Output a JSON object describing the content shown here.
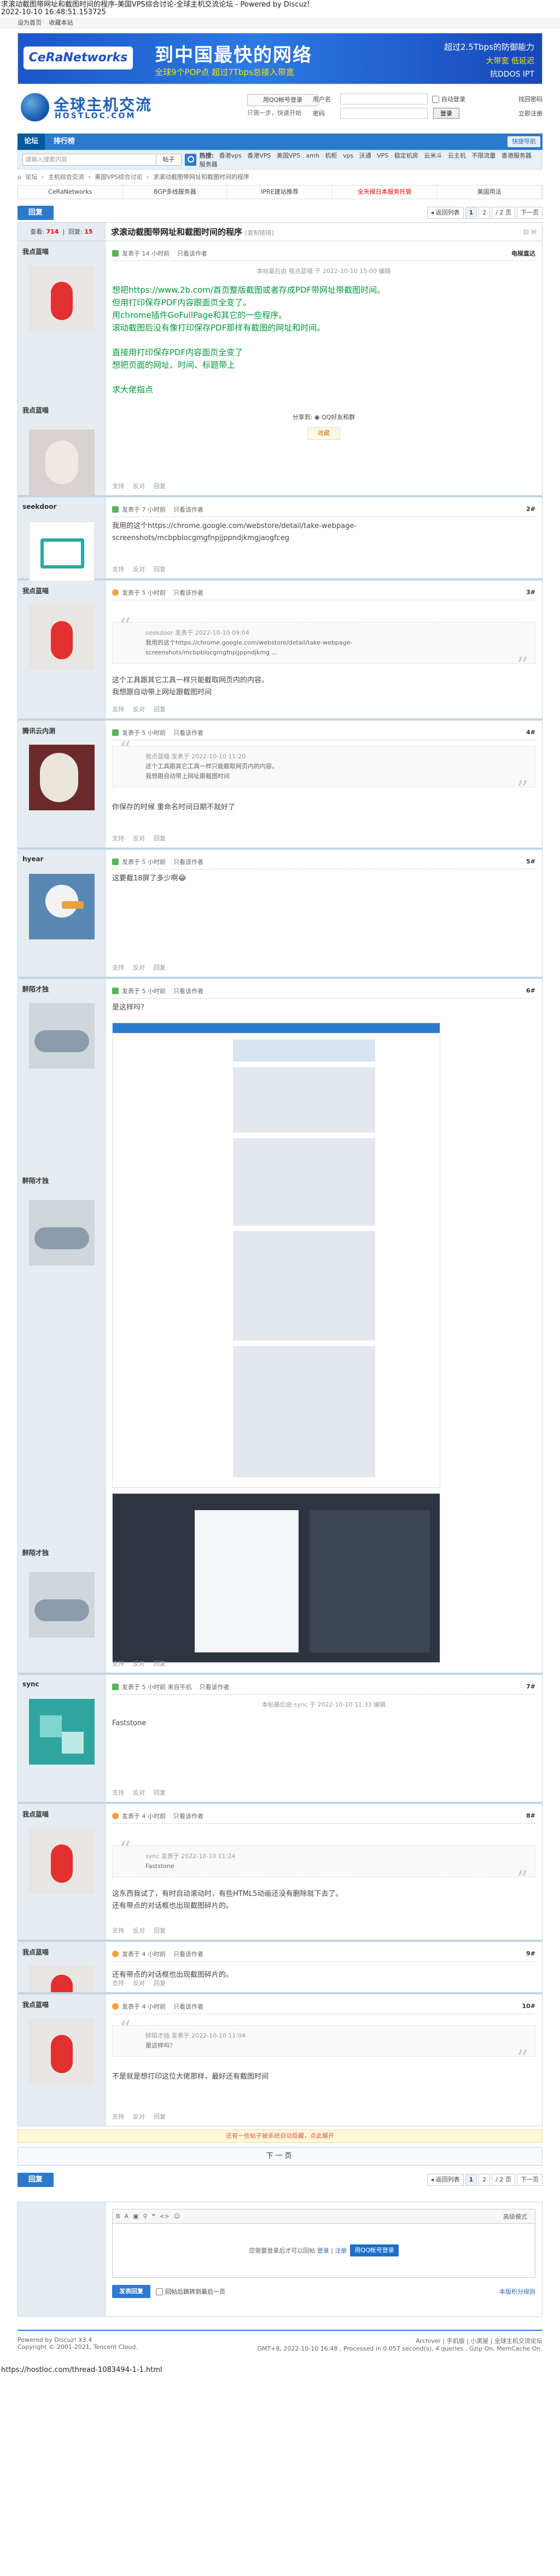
{
  "print_header": {
    "title": "求滚动截图带网址和截图时间的程序-美国VPS综合讨论-全球主机交流论坛 - Powered by Discuz!",
    "timestamp": "2022-10-10 16:48:51.153725"
  },
  "topbar": {
    "set_home": "设为首页",
    "favorite": "收藏本站"
  },
  "ad_banner": {
    "logo": "CeRaNetworks",
    "headline": "到中国最快的网络",
    "subline": "全球9个POP点  超过7Tbps总接入带宽",
    "right1": "超过2.5Tbps的防御能力",
    "right2": "大带宽 低延迟",
    "right3": "抗DDOS IPT"
  },
  "site": {
    "logo_cn": "全球主机交流",
    "logo_en": "HOSTLOC.COM",
    "qq_login": "用QQ帐号登录",
    "qq_tip": "只需一步，快速开始"
  },
  "login": {
    "user_label": "用户名",
    "pass_label": "密码",
    "autologin": "自动登录",
    "forgot": "找回密码",
    "login_btn": "登录",
    "register": "立即注册"
  },
  "nav": {
    "items": [
      "论坛",
      "排行榜"
    ],
    "quick": "快捷导航"
  },
  "search": {
    "placeholder": "请输入搜索内容",
    "scope": "帖子",
    "hot_label": "热搜:",
    "hot": [
      "香港vps",
      "香港VPS",
      "美国VPS",
      "amh",
      "机柜",
      "vps",
      "沃通",
      "VPS",
      "稳定机房",
      "云米斗",
      "云主机",
      "不限流量",
      "香港服务器",
      "服务器"
    ]
  },
  "breadcrumb": [
    "论坛",
    "›",
    "主机综合交流",
    "›",
    "美国VPS综合讨论",
    "›",
    "求滚动截图带网址和截图时间的程序"
  ],
  "links": [
    "CeRaNetworks",
    "BGP多线服务器",
    "IPRE建站推荐",
    "全天候日本服务托管",
    "美国用法"
  ],
  "pagination": {
    "back": "◂ 返回列表",
    "pages": [
      "1",
      "2"
    ],
    "total": "/ 2 页",
    "next": "下一页",
    "reply": "回复"
  },
  "thread": {
    "views_label": "查看:",
    "views": "714",
    "replies_label": "回复:",
    "replies": "15",
    "title": "求滚动截图带网址和截图时间的程序",
    "copy_link": "[复制链接]",
    "tools": "⊟ ✉"
  },
  "posts": [
    {
      "author": "我点蓝喵",
      "meta": "发表于 14 小时前",
      "only_author": "只看该作者",
      "floor": "电梯直达",
      "edited": "本帖最后由 我点蓝喵 于 2022-10-10 15:00 编辑",
      "lines": [
        "想把https://www.2b.com/首页整版截图或者存成PDF带网址带截图时间。",
        "但用打印保存PDF内容跟面页全变了。",
        "用chrome插件GoFullPage和其它的一些程序。",
        "滚动截图后没有像打印保存PDF那样有截图的网址和时间。",
        "",
        "直接用打印保存PDF内容面页全变了",
        "想把页面的网址、时间、标题带上",
        "",
        "求大佬指点"
      ],
      "share": "分享到: ◉ QQ好友和群",
      "fav": "收藏"
    },
    {
      "author": "seekdoor",
      "meta": "发表于 7 小时前",
      "only_author": "只看该作者",
      "floor": "2#",
      "lines": [
        "我用的这个https://chrome.google.com/webstore/detail/take-webpage-",
        "screenshots/mcbpblocgmgfnpjjppndjkmgjaogfceg"
      ]
    },
    {
      "author": "我点蓝喵",
      "meta": "发表于 5 小时前",
      "only_author": "只看该作者",
      "floor": "3#",
      "quote_head": "seekdoor 发表于 2022-10-10 09:04",
      "quote": [
        "我用的这个https://chrome.google.com/webstore/detail/take-webpage-",
        "screenshots/mcbpblocgmgfnpjjppndjkmg ..."
      ],
      "lines": [
        "这个工具跟其它工具一样只能截取网页内的内容。",
        "我想跟自动带上网址跟截图时间"
      ]
    },
    {
      "author": "腾讯云内测",
      "meta": "发表于 5 小时前",
      "only_author": "只看该作者",
      "floor": "4#",
      "quote_head": "我点蓝喵 发表于 2022-10-10 11:20",
      "quote": [
        "这个工具跟其它工具一样只能截取网页内的内容。",
        "我想跟自动带上网址跟截图时间"
      ],
      "lines": [
        "你保存的时候 重命名时间日期不就好了"
      ]
    },
    {
      "author": "hyear",
      "meta": "发表于 5 小时前",
      "only_author": "只看该作者",
      "floor": "5#",
      "lines": [
        "这要截18屏了多少啊😂"
      ]
    },
    {
      "author": "醉陌才独",
      "meta": "发表于 5 小时前",
      "only_author": "只看该作者",
      "floor": "6#",
      "lines": [
        "是这样吗？"
      ]
    },
    {
      "author": "sync",
      "meta": "发表于 5 小时前 来自手机",
      "only_author": "只看该作者",
      "floor": "7#",
      "edited": "本帖最后由 sync 于 2022-10-10 11:33 编辑",
      "lines": [
        "Faststone"
      ]
    },
    {
      "author": "我点蓝喵",
      "meta": "发表于 4 小时前",
      "only_author": "只看该作者",
      "floor": "8#",
      "quote_head": "sync 发表于 2022-10-10 11:24",
      "quote": [
        "Faststone"
      ],
      "lines": [
        "这东西我试了，有时自动滚动时，有些HTML5动画还没有删除就下去了。",
        "还有带点的对话框也出现截图碎片的。"
      ]
    },
    {
      "author": "我点蓝喵",
      "meta": "发表于 4 小时前",
      "only_author": "只看该作者",
      "floor": "9#",
      "lines": [
        "还有带点的对话框也出现截图碎片的。"
      ]
    },
    {
      "author": "我点蓝喵",
      "meta": "发表于 4 小时前",
      "only_author": "只看该作者",
      "floor": "10#",
      "quote_head": "醉陌才独 发表于 2022-10-10 11:04",
      "quote": [
        "是这样吗？"
      ],
      "lines": [
        "不是就是想打印这位大佬那样，最好还有截图时间"
      ]
    }
  ],
  "post_actions": {
    "support": "支持",
    "oppose": "反对",
    "reply": "回复"
  },
  "notice": "还有一些帖子被系统自动隐藏，点此展开",
  "next_page": "下一页",
  "fastpost": {
    "adv_mode": "高级模式",
    "need_login": "您需要登录后才可以回帖",
    "login": "登录",
    "register": "注册",
    "qq": "用QQ帐号登录",
    "send": "发表回复",
    "back_list": "回帖后跳转到最后一页",
    "rule": "本版积分规则"
  },
  "footer": {
    "powered": "Powered by Discuz! X3.4",
    "copyright": "Copyright © 2001-2021, Tencent Cloud.",
    "links": "Archiver | 手机版 | 小黑屋 | 全球主机交流论坛",
    "gmt": "GMT+8, 2022-10-10 16:48 , Processed in 0.057 second(s), 4 queries , Gzip On, MemCache On."
  },
  "url_footer": "https://hostloc.com/thread-1083494-1-1.html"
}
